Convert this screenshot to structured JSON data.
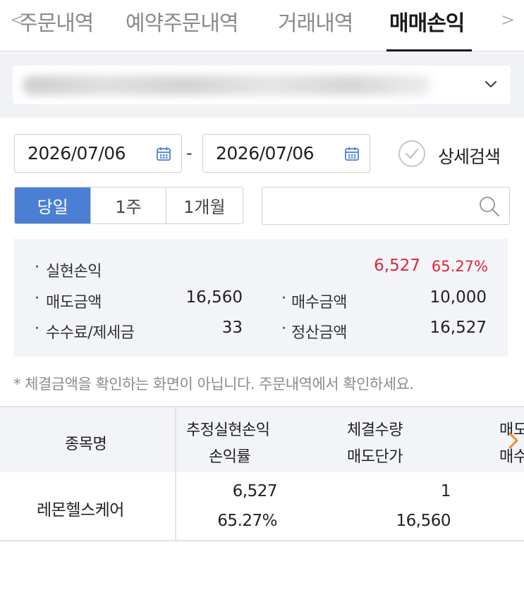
{
  "tabs": [
    {
      "label": "주문내역",
      "active": false
    },
    {
      "label": "예약주문내역",
      "active": false
    },
    {
      "label": "거래내역",
      "active": false
    },
    {
      "label": "매매손익",
      "active": true
    }
  ],
  "date_range": {
    "start": "2026/07/06",
    "separator": "-",
    "end": "2026/07/06"
  },
  "detail_search_label": "상세검색",
  "periods": [
    {
      "label": "당일",
      "active": true
    },
    {
      "label": "1주",
      "active": false
    },
    {
      "label": "1개월",
      "active": false
    }
  ],
  "search": {
    "value": "",
    "placeholder": ""
  },
  "summary": {
    "realized_pl_label": "실현손익",
    "realized_pl_value": "6,527",
    "realized_pl_rate": "65.27%",
    "sell_amount_label": "매도금액",
    "sell_amount_value": "16,560",
    "buy_amount_label": "매수금액",
    "buy_amount_value": "10,000",
    "fee_tax_label": "수수료/제세금",
    "fee_tax_value": "33",
    "settlement_label": "정산금액",
    "settlement_value": "16,527"
  },
  "notice": "* 체결금액을 확인하는 화면이 아닙니다. 주문내역에서 확인하세요.",
  "table": {
    "headers": {
      "name": "종목명",
      "est_pl": "추정실현손익",
      "pl_rate": "손익률",
      "qty": "체결수량",
      "sell_price": "매도단가",
      "next_top": "매도",
      "next_bottom": "매수"
    },
    "rows": [
      {
        "name": "레몬헬스케어",
        "est_pl": "6,527",
        "pl_rate": "65.27%",
        "qty": "1",
        "sell_price": "16,560"
      }
    ]
  },
  "colors": {
    "accent": "#4a7fd4",
    "profit": "#d8283a",
    "arrow": "#f28a2e"
  }
}
